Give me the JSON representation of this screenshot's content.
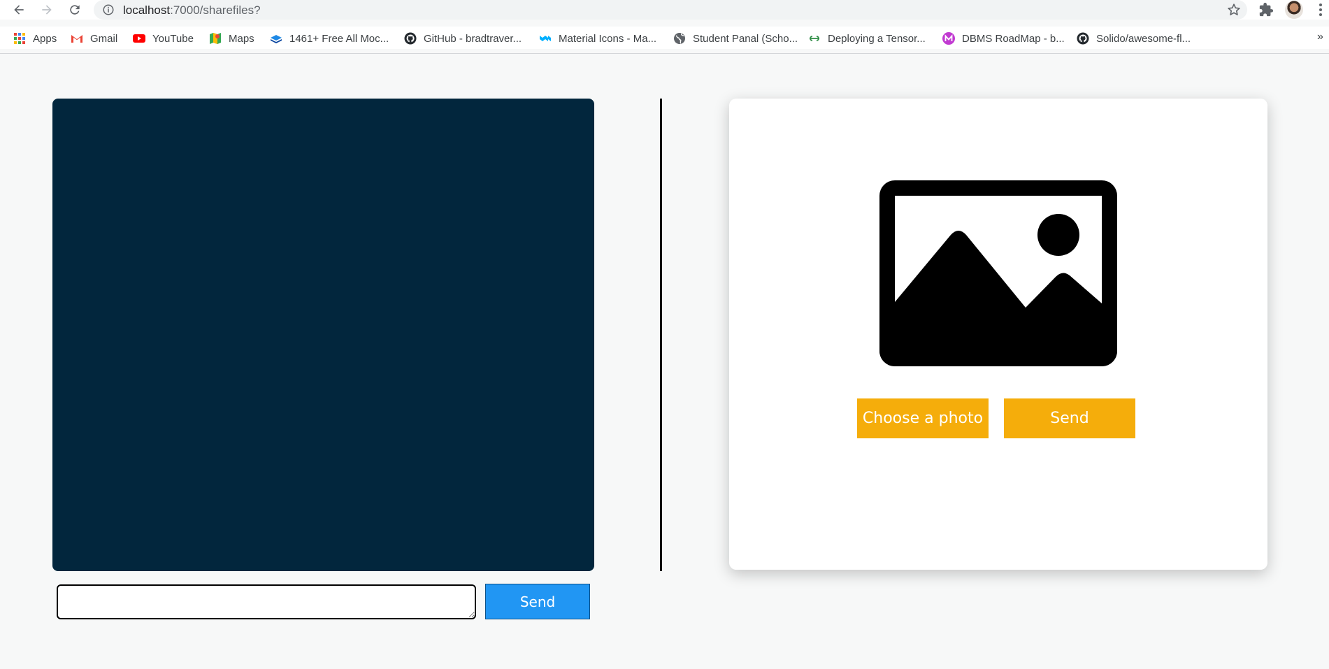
{
  "browser": {
    "url_host": "localhost",
    "url_path": ":7000/sharefiles?",
    "bookmarks": [
      {
        "label": "Apps",
        "icon": "apps-grid-icon"
      },
      {
        "label": "Gmail",
        "icon": "gmail-icon"
      },
      {
        "label": "YouTube",
        "icon": "youtube-icon"
      },
      {
        "label": "Maps",
        "icon": "maps-icon"
      },
      {
        "label": "1461+ Free All Moc...",
        "icon": "layers-icon"
      },
      {
        "label": "GitHub - bradtraver...",
        "icon": "github-icon"
      },
      {
        "label": "Material Icons - Ma...",
        "icon": "material-icon"
      },
      {
        "label": "Student Panal (Scho...",
        "icon": "globe-icon"
      },
      {
        "label": "Deploying a Tensor...",
        "icon": "gfg-icon"
      },
      {
        "label": "DBMS RoadMap - b...",
        "icon": "letter-m-icon"
      },
      {
        "label": "Solido/awesome-fl...",
        "icon": "github-icon"
      }
    ],
    "more_glyph": "»"
  },
  "chat": {
    "input_value": "",
    "send_label": "Send"
  },
  "upload": {
    "choose_label": "Choose a photo",
    "send_label": "Send"
  },
  "colors": {
    "video_bg": "#02263d",
    "send_blue": "#2196f3",
    "accent_yellow": "#f5ad0b"
  }
}
